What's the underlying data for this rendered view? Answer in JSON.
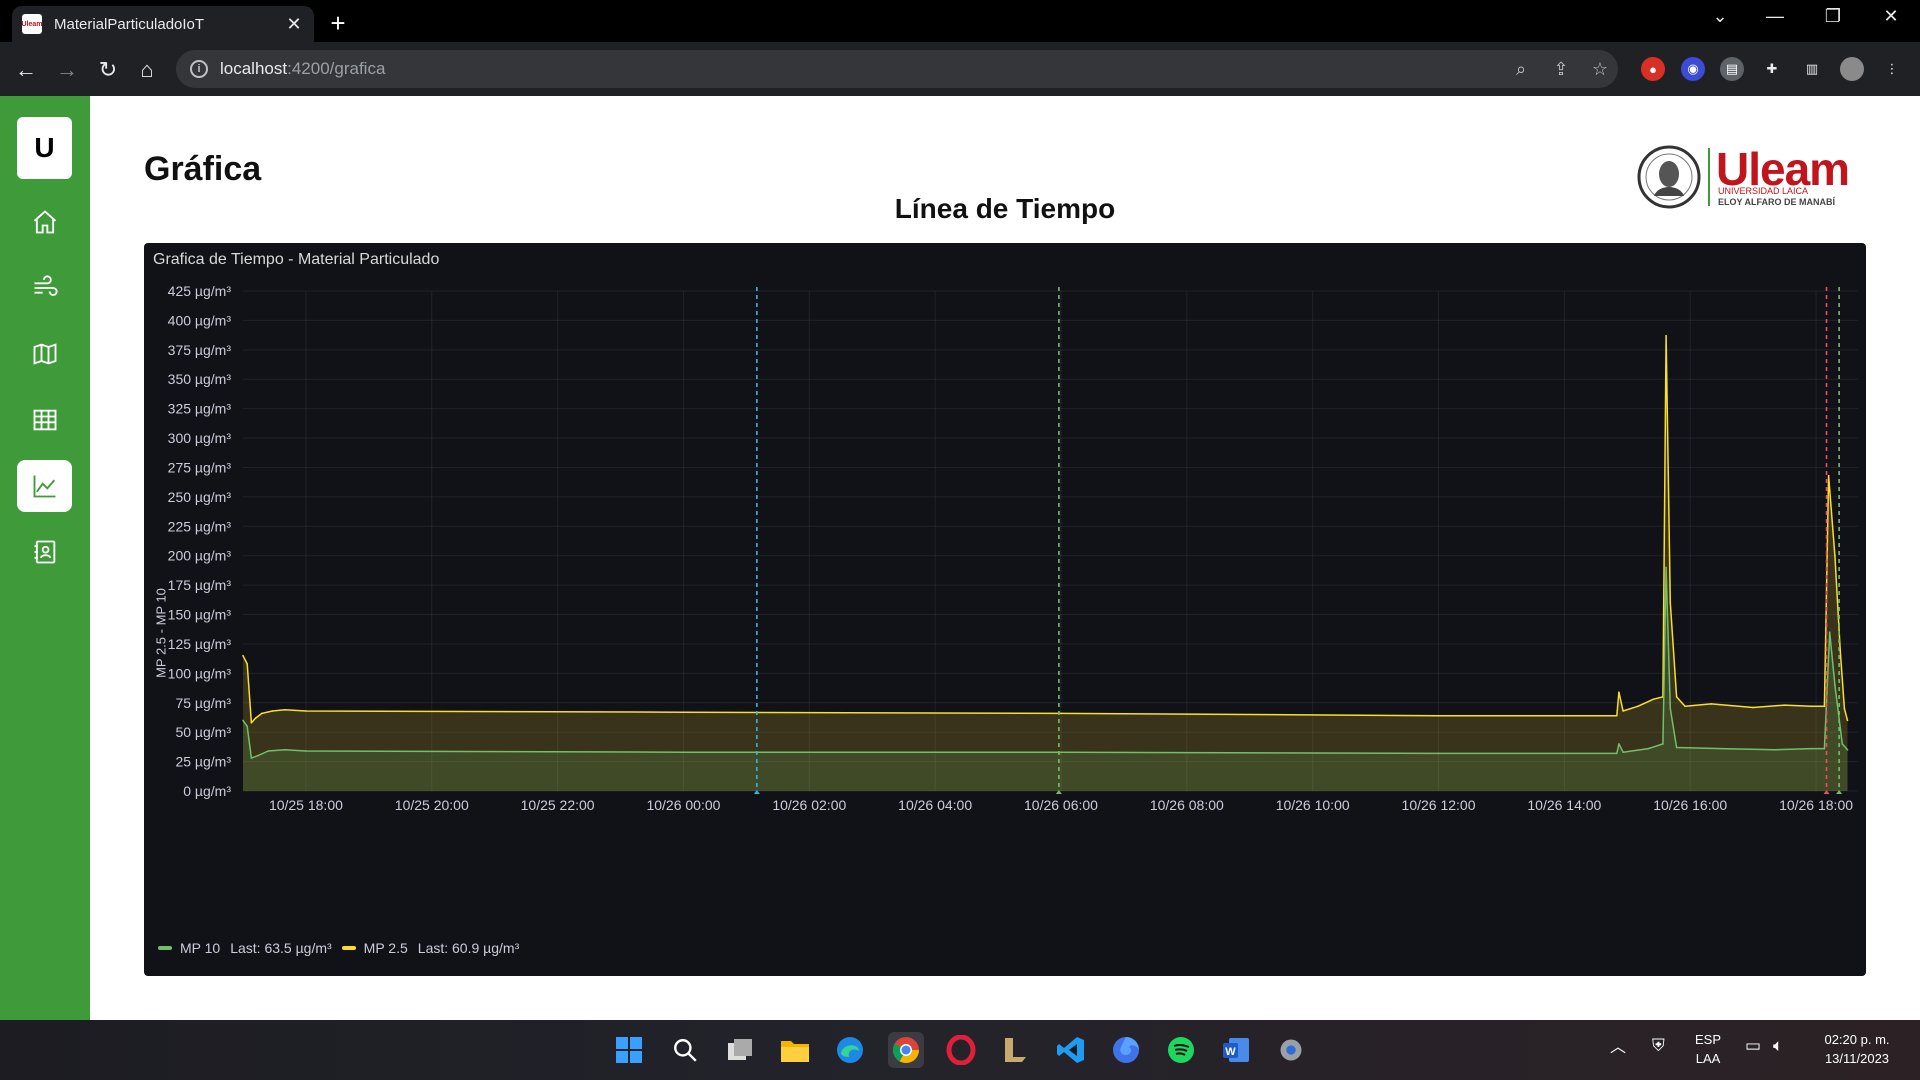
{
  "browser": {
    "tab_title": "MaterialParticuladoIoT",
    "favicon_text": "Uleam",
    "url_host": "localhost",
    "url_rest": ":4200/grafica"
  },
  "sidebar": {
    "logo_letter": "U",
    "items": [
      {
        "icon": "home-icon"
      },
      {
        "icon": "wind-icon"
      },
      {
        "icon": "map-icon"
      },
      {
        "icon": "table-icon"
      },
      {
        "icon": "chart-icon",
        "active": true
      },
      {
        "icon": "contacts-icon"
      }
    ]
  },
  "page": {
    "title": "Gráfica",
    "chart_heading": "Línea de Tiempo",
    "brand": {
      "name": "Uleam",
      "line1": "UNIVERSIDAD LAICA",
      "line2": "ELOY ALFARO DE MANABÍ"
    }
  },
  "panel": {
    "title": "Grafica de Tiempo - Material Particulado",
    "ylabel": "MP 2.5 - MP 10",
    "legend": [
      {
        "name": "MP 10",
        "last": "Last: 63.5 µg/m³",
        "color": "#73bf69"
      },
      {
        "name": "MP 2.5",
        "last": "Last: 60.9 µg/m³",
        "color": "#fade2a"
      }
    ]
  },
  "chart_data": {
    "type": "area",
    "title": "Grafica de Tiempo - Material Particulado",
    "ylabel": "MP 2.5 - MP 10",
    "y_unit": "µg/m³",
    "ylim": [
      0,
      425
    ],
    "y_ticks": [
      "0 µg/m³",
      "25 µg/m³",
      "50 µg/m³",
      "75 µg/m³",
      "100 µg/m³",
      "125 µg/m³",
      "150 µg/m³",
      "175 µg/m³",
      "200 µg/m³",
      "225 µg/m³",
      "250 µg/m³",
      "275 µg/m³",
      "300 µg/m³",
      "325 µg/m³",
      "350 µg/m³",
      "375 µg/m³",
      "400 µg/m³",
      "425 µg/m³"
    ],
    "x_ticks": [
      "10/25 18:00",
      "10/25 20:00",
      "10/25 22:00",
      "10/26 00:00",
      "10/26 02:00",
      "10/26 04:00",
      "10/26 06:00",
      "10/26 08:00",
      "10/26 10:00",
      "10/26 12:00",
      "10/26 14:00",
      "10/26 16:00",
      "10/26 18:00"
    ],
    "xlim": [
      "10/25 17:00",
      "10/26 18:40"
    ],
    "grid": true,
    "legend_position": "bottom-left",
    "annotations": [
      {
        "time": "10/26 01:10",
        "color": "#33b5e5"
      },
      {
        "time": "10/26 05:58",
        "color": "#73bf69"
      },
      {
        "time": "10/26 18:10",
        "color": "#f2495c"
      },
      {
        "time": "10/26 18:22",
        "color": "#73bf69"
      }
    ],
    "series": [
      {
        "name": "MP 2.5",
        "color": "#fade2a",
        "points": [
          [
            "10/25 17:00",
            115
          ],
          [
            "10/25 17:04",
            108
          ],
          [
            "10/25 17:08",
            58
          ],
          [
            "10/25 17:12",
            62
          ],
          [
            "10/25 17:18",
            66
          ],
          [
            "10/25 17:28",
            68
          ],
          [
            "10/25 17:40",
            69
          ],
          [
            "10/25 18:00",
            68
          ],
          [
            "10/26 00:00",
            67
          ],
          [
            "10/26 06:00",
            66
          ],
          [
            "10/26 12:00",
            64
          ],
          [
            "10/26 14:50",
            64
          ],
          [
            "10/26 14:52",
            84
          ],
          [
            "10/26 14:56",
            68
          ],
          [
            "10/26 15:10",
            72
          ],
          [
            "10/26 15:25",
            78
          ],
          [
            "10/26 15:34",
            80
          ],
          [
            "10/26 15:37",
            387
          ],
          [
            "10/26 15:41",
            160
          ],
          [
            "10/26 15:47",
            80
          ],
          [
            "10/26 15:55",
            72
          ],
          [
            "10/26 16:20",
            74
          ],
          [
            "10/26 17:00",
            71
          ],
          [
            "10/26 17:30",
            73
          ],
          [
            "10/26 17:55",
            72
          ],
          [
            "10/26 18:08",
            72
          ],
          [
            "10/26 18:12",
            268
          ],
          [
            "10/26 18:18",
            200
          ],
          [
            "10/26 18:23",
            120
          ],
          [
            "10/26 18:27",
            70
          ],
          [
            "10/26 18:30",
            60
          ]
        ]
      },
      {
        "name": "MP 10",
        "color": "#73bf69",
        "points": [
          [
            "10/25 17:00",
            60
          ],
          [
            "10/25 17:04",
            55
          ],
          [
            "10/25 17:08",
            28
          ],
          [
            "10/25 17:14",
            30
          ],
          [
            "10/25 17:24",
            34
          ],
          [
            "10/25 17:40",
            35
          ],
          [
            "10/25 18:00",
            34
          ],
          [
            "10/26 00:00",
            33
          ],
          [
            "10/26 06:00",
            33
          ],
          [
            "10/26 12:00",
            32
          ],
          [
            "10/26 14:50",
            32
          ],
          [
            "10/26 14:52",
            40
          ],
          [
            "10/26 14:56",
            33
          ],
          [
            "10/26 15:20",
            36
          ],
          [
            "10/26 15:34",
            40
          ],
          [
            "10/26 15:37",
            190
          ],
          [
            "10/26 15:41",
            70
          ],
          [
            "10/26 15:47",
            37
          ],
          [
            "10/26 16:30",
            36
          ],
          [
            "10/26 17:20",
            35
          ],
          [
            "10/26 17:55",
            36
          ],
          [
            "10/26 18:08",
            36
          ],
          [
            "10/26 18:13",
            135
          ],
          [
            "10/26 18:18",
            90
          ],
          [
            "10/26 18:25",
            40
          ],
          [
            "10/26 18:30",
            35
          ]
        ]
      }
    ]
  },
  "taskbar": {
    "apps": [
      "windows-start-icon",
      "search-icon",
      "task-view-icon",
      "file-explorer-icon",
      "edge-icon",
      "chrome-icon",
      "opera-icon",
      "league-icon",
      "vscode-icon",
      "firefox-icon",
      "spotify-icon",
      "word-icon",
      "settings-icon"
    ],
    "lang_line1": "ESP",
    "lang_line2": "LAA",
    "time": "02:20 p. m.",
    "date": "13/11/2023"
  }
}
